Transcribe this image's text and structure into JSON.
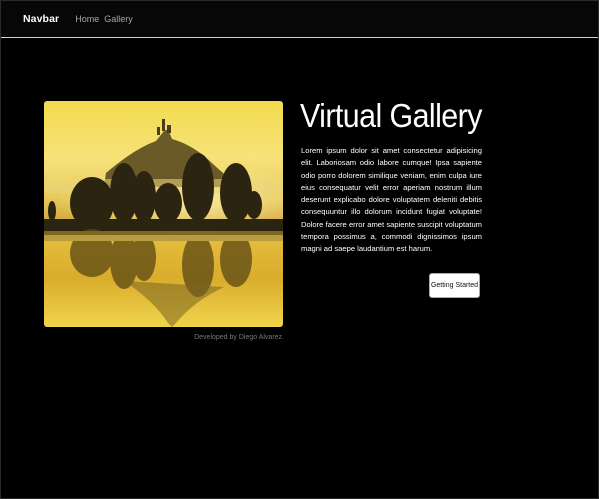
{
  "navbar": {
    "brand": "Navbar",
    "links": [
      "Home",
      "Gallery"
    ]
  },
  "hero": {
    "image_label": "landscape-photo",
    "credit": "Developed by Diego Alvarez.",
    "title": "Virtual Gallery",
    "description": "Lorem ipsum dolor sit amet consectetur adipisicing elit. Laboriosam odio labore cumque! Ipsa sapiente odio porro dolorem similique veniam, enim culpa iure eius consequatur velit error aperiam nostrum illum deserunt explicabo dolore voluptatem deleniti debitis consequuntur illo dolorum incidunt fugiat voluptate! Dolore facere error amet sapiente suscipit voluptatum tempora possimus a, commodi dignissimos ipsum magni ad saepe laudantium est harum.",
    "button_label": "Getting Started"
  },
  "colors": {
    "background": "#000000",
    "navbar_border": "#cfcfcf",
    "photo_sky": "#f2d34a",
    "photo_water": "#caa22a"
  }
}
